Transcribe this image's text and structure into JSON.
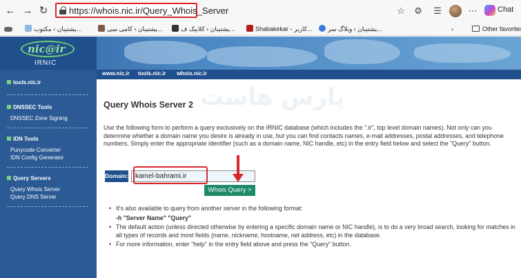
{
  "browser": {
    "url": "https://whois.nic.ir/Query_Whois_Server",
    "chat_label": "Chat",
    "bookmarks": [
      "پشتیبان › مکتوب...",
      "پشتیبان › کامی سی...",
      "پشتیبان › کلابیک ف...",
      "Shabakekar - کاربر...",
      "پشتیبان › وبلاگ سر...",
      "Other favorites"
    ]
  },
  "site": {
    "logo_text": "nic@ir",
    "logo_sub": "IRNIC",
    "topnav": [
      "www.nic.ir",
      "tools.nic.ir",
      "whois.nic.ir"
    ],
    "sidebar": {
      "tools_link": "tools.nic.ir",
      "dnssec_head": "DNSSEC Tools",
      "dnssec_link": "DNSSEC Zone Signing",
      "idn_head": "IDN Tools",
      "idn_link1": "Punycode Converter",
      "idn_link2": "IDN Config Generator",
      "query_head": "Query Servers",
      "query_link1": "Query Whois Server",
      "query_link2": "Query DNS Server"
    },
    "watermark": "پارس هاست"
  },
  "main": {
    "title": "Query Whois Server 2",
    "intro": "Use the following form to perform a query exclusively on the IRNIC database (which includes the \".ir\", top level domain names). Not only can you determine whether a domain name you desire is already in use, but you can find contacts names, e-mail addresses, postal addresses, and telephone numbers. Simply enter the appropriate identifier (such as a domain name, NIC handle, etc) in the entry field below and select the \"Query\" button.",
    "domain_label": "Domain:",
    "domain_value": "kamel-bahrami.ir",
    "query_button": "Whois Query >",
    "notes": [
      "It's also available to query from another server in the following format:",
      "-h \"Server Name\" \"Query\"",
      "The default action (unless directed otherwise by entering a specific domain name or NIC handle), is to do a very broad search, looking for matches in all types of records and most fields (name, nickname, hostname, net address, etc) in the database.",
      "For more information, enter \"help\" in the entry field above and press the \"Query\" button."
    ]
  },
  "colors": {
    "highlight": "#d9262b",
    "sidebar": "#2b5a94",
    "button": "#1e8a6a"
  }
}
